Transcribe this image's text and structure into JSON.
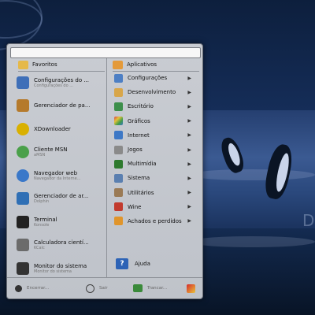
{
  "wallpaper": {
    "letter": "D"
  },
  "search": {
    "value": ""
  },
  "favorites": {
    "title": "Favoritos",
    "items": [
      {
        "name": "Configurações do ...",
        "sub": "Configurações do ...",
        "color": "#3f6fb8"
      },
      {
        "name": "Gerenciador de pa...",
        "sub": "",
        "color": "#b57a2c"
      },
      {
        "name": "XDownloader",
        "sub": "",
        "color": "#d9b000"
      },
      {
        "name": "Cliente MSN",
        "sub": "aMSN",
        "color": "#4aa04a"
      },
      {
        "name": "Navegador web",
        "sub": "Navegador da Interne...",
        "color": "#3a78c9"
      },
      {
        "name": "Gerenciador de ar...",
        "sub": "Dolphin",
        "color": "#2f6fb5"
      },
      {
        "name": "Terminal",
        "sub": "Konsole",
        "color": "#222222"
      },
      {
        "name": "Calculadora cientí...",
        "sub": "KCalc",
        "color": "#6b6b6b"
      },
      {
        "name": "Monitor do sistema",
        "sub": "Monitor do sistema",
        "color": "#333333"
      }
    ]
  },
  "applications": {
    "title": "Aplicativos",
    "items": [
      {
        "label": "Configurações",
        "color": "#4d7fc4",
        "submenu": true
      },
      {
        "label": "Desenvolvimento",
        "color": "#d8a64a",
        "submenu": true
      },
      {
        "label": "Escritório",
        "color": "#3d8f4b",
        "submenu": true
      },
      {
        "label": "Gráficos",
        "color": "#d9454a",
        "submenu": true
      },
      {
        "label": "Internet",
        "color": "#3d78c6",
        "submenu": true
      },
      {
        "label": "Jogos",
        "color": "#8a8a8a",
        "submenu": true
      },
      {
        "label": "Multimídia",
        "color": "#2e7a2e",
        "submenu": true
      },
      {
        "label": "Sistema",
        "color": "#5a7fb0",
        "submenu": true
      },
      {
        "label": "Utilitários",
        "color": "#9a7a55",
        "submenu": true
      },
      {
        "label": "Wine",
        "color": "#c23b2e",
        "submenu": true
      },
      {
        "label": "Achados e perdidos",
        "color": "#e0952b",
        "submenu": true
      }
    ],
    "help_label": "Ajuda",
    "arrow": "▶"
  },
  "bottom": {
    "logout": "Encerrar...",
    "leave": "Sair",
    "lock": "Trancar..."
  }
}
